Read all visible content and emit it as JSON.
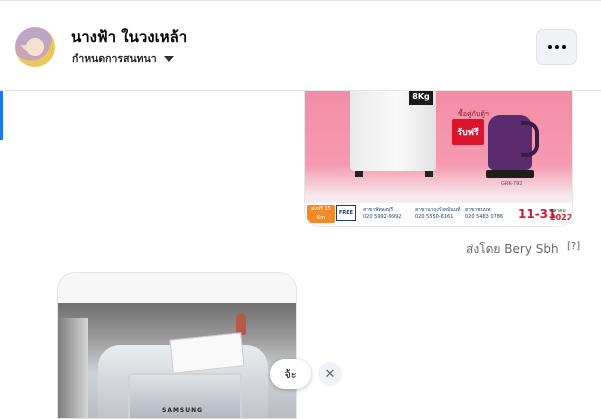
{
  "header": {
    "contact_name": "นางฟ้า ในวงเหล้า",
    "subtitle": "กำหนดการสนทนา",
    "more_icon": "more-horizontal-icon"
  },
  "ad": {
    "washer_capacity": "8Kg",
    "promo_caption": "ซื้อคู่กับตู้ฯ",
    "promo_badge": "รับฟรี",
    "model": "GRK-792",
    "delivery_label": "ส่งฟรี 15 Km",
    "truck_label": "FREE",
    "contacts": [
      {
        "name": "สาขาพัทลุงบุรี",
        "phone": "020 5992-9992"
      },
      {
        "name": "สาขานาถุงรังสมันนท์",
        "phone": "020 5550-6161"
      },
      {
        "name": "สาขาชนบท",
        "phone": "020 5483 0786"
      }
    ],
    "date_range": "11-31",
    "year_label": "ตุลาคม",
    "year": "2022"
  },
  "message_meta": {
    "sent_by": "ส่งโดย Bery Sbh",
    "help_icon": "help-icon"
  },
  "media": {
    "brand": "SAMSUNG"
  },
  "quick_reply": {
    "label": "จ้ะ",
    "close_icon": "close-icon"
  }
}
